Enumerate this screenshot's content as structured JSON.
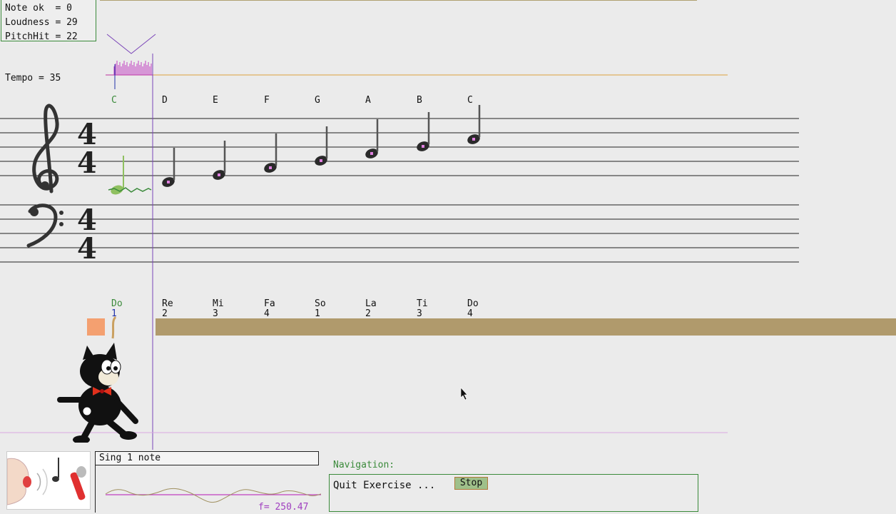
{
  "stats": {
    "note_ok": "Note ok  = 0",
    "loudness": "Loudness = 29",
    "pitchhit": "PitchHit = 22"
  },
  "tempo": "Tempo = 35",
  "time_signature": {
    "top": "4",
    "bottom": "4"
  },
  "note_names": [
    "C",
    "D",
    "E",
    "F",
    "G",
    "A",
    "B",
    "C"
  ],
  "solfege": [
    {
      "name": "Do",
      "beat": "1"
    },
    {
      "name": "Re",
      "beat": "2"
    },
    {
      "name": "Mi",
      "beat": "3"
    },
    {
      "name": "Fa",
      "beat": "4"
    },
    {
      "name": "So",
      "beat": "1"
    },
    {
      "name": "La",
      "beat": "2"
    },
    {
      "name": "Ti",
      "beat": "3"
    },
    {
      "name": "Do",
      "beat": "4"
    }
  ],
  "task": "Sing 1 note",
  "frequency": "f= 250.47",
  "navigation": {
    "title": "Navigation:",
    "quit_label": "Quit Exercise ...",
    "stop_label": "Stop"
  },
  "colors": {
    "active": "#3a8a3a",
    "progress": "#b09a6c",
    "marker": "#f4a070",
    "cursor_line": "#7a44b8",
    "pitch_trace": "#c040c0",
    "tempo_line": "#e0b060"
  },
  "icons": {
    "treble_clef": "treble-clef-icon",
    "bass_clef": "bass-clef-icon",
    "mascot": "cartoon-cat-icon",
    "singer": "singer-microphone-icon",
    "stop": "stop-button"
  }
}
